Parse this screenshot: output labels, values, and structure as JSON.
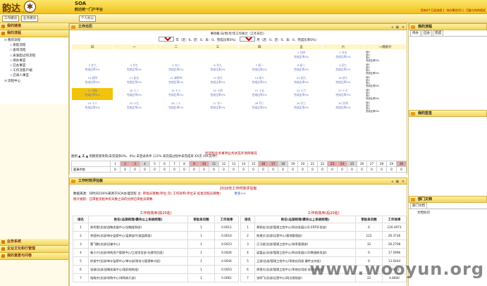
{
  "header": {
    "logo_text": "韵达",
    "logo_sub": "YUNDA EXPRESS",
    "logo_mark": "✱",
    "app_title": "SOA",
    "app_subtitle": "韵达统一门户平台",
    "links": [
      "您有0个已阅流程",
      "待办事宜(0)",
      "可能与你的相关"
    ]
  },
  "tabs": [
    "工作模块",
    "业务模块",
    "个人办公"
  ],
  "sidebar": {
    "sections": [
      "我的链接",
      "我的流程",
      "业务系统",
      "企业文化和行管理",
      "我的意愿与问卷"
    ],
    "tree": {
      "root": "我的流程",
      "items": [
        "发起流程",
        "查询流程",
        "表发起过的流程",
        "待办事宜",
        "已办事宜",
        "工作流客户端",
        "已阅人事宜"
      ],
      "last": "流程中心"
    }
  },
  "calendar": {
    "panel_title": "工作日历",
    "heading": "事项概 日/周/月/年工作统计（工作日历）",
    "year_label": "年（迟：0、迟：0、未：0、完成比率0%）",
    "month_label": "月（迟：0、迟：0、未：0、完成比率0%）",
    "year": "2016",
    "month": "4",
    "weekdays": [
      "日",
      "一",
      "二",
      "三",
      "四",
      "五",
      "六"
    ],
    "week_col": "一周统计",
    "weeks": [
      [
        "",
        "",
        "",
        "",
        "",
        "1 廿四",
        "2 廿五"
      ],
      [
        "3 廿六",
        "4 廿七",
        "5 廿八",
        "6 廿九",
        "7 初一",
        "8 初二",
        "9 初三"
      ],
      [
        "10 初四",
        "11 初五",
        "12 清明节",
        "13 初七",
        "14 初八",
        "15 初九",
        "16 初十"
      ],
      [
        "17 谷雨",
        "18 十二",
        "19 十三",
        "20 十四",
        "21 十五",
        "22 十六",
        "23 十七"
      ],
      [
        "24 十八",
        "25 十九",
        "26 二十",
        "27 廿一",
        "28 廿二",
        "29 廿三",
        "30 廿四"
      ]
    ],
    "cell_status": "完成比率0%",
    "week_stats": [
      "待0",
      "迟0",
      "未0",
      "完成比率0%"
    ],
    "note": "图例   ▲  未   ▲  到期受理项目(未完成率0%、0%)  未登录条件 111%  未完成过程中未完成率 XX次  (XX次/件)",
    "note_red": "因流程业务事项业务状态外项目情况",
    "day_bar_label": "要事件数",
    "days": [
      "1",
      "2",
      "3",
      "4",
      "5",
      "6",
      "7",
      "8",
      "9",
      "10",
      "11",
      "12",
      "13",
      "14",
      "15",
      "16",
      "17",
      "18",
      "19",
      "20",
      "21",
      "22",
      "23",
      "24",
      "25",
      "26",
      "27",
      "28",
      "29",
      "30"
    ],
    "day_values": [
      "0",
      "0",
      "0",
      "0",
      "0",
      "0",
      "0",
      "0",
      "0",
      "0",
      "0",
      "0",
      "0",
      "0",
      "0",
      "0",
      "0",
      "0",
      "0",
      "0",
      "0",
      "0",
      "0",
      "0",
      "0",
      "0",
      "0",
      "0",
      "0",
      "0"
    ],
    "red_days": [
      2,
      3,
      9,
      10,
      16,
      17,
      23,
      24,
      30
    ],
    "gray_days": [
      4,
      11,
      18,
      25
    ]
  },
  "evaluation": {
    "panel_title": "工作时效评估板",
    "title": "2016年工作时效评估板",
    "line1_prefix": "数据来源：同时间100%来源于SOA办理流程",
    "line1_a": "主: 审批员目数(单位:次)",
    "line1_b": "工作效率(单位天 延批流程员目数)",
    "line1_more": "更多>>",
    "line2": "统计规则：已审批流程共有天数之间的比例已审批员目数",
    "left": {
      "title": "工作有效序(前20名)",
      "headers": [
        "排名",
        "姓名(总部经理/模块以上系统经理)",
        "审批条目数",
        "工作效率"
      ],
      "rows": [
        [
          "1",
          "郑秀雯(总部/战略发展中心/战略规划部)",
          "1",
          "0.0011"
        ],
        [
          "2",
          "李国伟(总部/审计监察中心/监察部/行政监察组)",
          "1",
          "0.0014"
        ],
        [
          "3",
          "董飞鹏(总部/运输中心)",
          "1",
          "0.0023"
        ],
        [
          "4",
          "秦小兴(总部/采购资产管理中心/工程项目部-在建项目组)",
          "1",
          "0.0026"
        ],
        [
          "5",
          "徐振宇(总部/审计监察中心/审计部/财务与管理审计组)",
          "1",
          "0.0044"
        ],
        [
          "6",
          "张瑞(总部/战略发展中心/组织结构组)",
          "1",
          "0.0053"
        ],
        [
          "7",
          "钱政杰(总部/采购中心/采购执行部)",
          "1",
          "0.0061"
        ]
      ]
    },
    "right": {
      "title": "工作有效序(后20名)",
      "headers": [
        "排名",
        "姓名(总部经理/模块以上系统经理)",
        "审批条目数",
        "工作效率"
      ],
      "rows": [
        [
          "1",
          "黄帆宏(总部/管理工程中心/科技发展公司 ERP开发部)",
          "6",
          "126.4973"
        ],
        [
          "2",
          "陈建文(总部/运营中心/基地管理部)",
          "122",
          "26.3736"
        ],
        [
          "3",
          "汪习斌(总部/管理工程中心/体系管理部)",
          "32",
          "26.2708"
        ],
        [
          "4",
          "梁富云(总部/管理工程中心/科技发展公司/数据研发部)",
          "6",
          "17.5996"
        ],
        [
          "5",
          "王斌(总部/管理工程中心/系统应用部 硬件支持组)",
          "6",
          "13.0444"
        ],
        [
          "6",
          "周雪光(总部/管理工程中心/系统应用部 软件支持组)",
          "1",
          "7.0022"
        ],
        [
          "7",
          "张明飞(总部/运营中心/网点规划部)",
          "22",
          "4.8600"
        ]
      ]
    }
  },
  "right_panels": {
    "flow_title": "我的流程",
    "flow_tabs": [
      "待办",
      "已办",
      "完成"
    ],
    "sign_title": "我的签签",
    "docs_title": "部门文档",
    "docs_tab": "部门文档",
    "docs_header": "文档标识"
  },
  "watermark": "www.wooyun.org"
}
